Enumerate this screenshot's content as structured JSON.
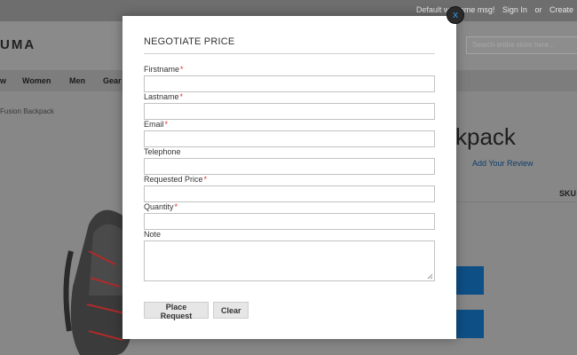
{
  "topbar": {
    "welcome": "Default welcome msg!",
    "sign_in": "Sign In",
    "or": "or",
    "create": "Create"
  },
  "header": {
    "logo_text": "UMA",
    "search_placeholder": "Search entire store here..."
  },
  "nav": {
    "items": [
      {
        "label": "w"
      },
      {
        "label": "Women"
      },
      {
        "label": "Men"
      },
      {
        "label": "Gear"
      }
    ]
  },
  "main": {
    "breadcrumb": "Fusion Backpack",
    "product_title": "kpack",
    "review_link": "Add Your Review",
    "sku_label": "SKU"
  },
  "modal": {
    "title": "NEGOTIATE PRICE",
    "close_label": "x",
    "fields": [
      {
        "label": "Firstname",
        "required": "*",
        "value": ""
      },
      {
        "label": "Lastname",
        "required": "*",
        "value": ""
      },
      {
        "label": "Email",
        "required": "*",
        "value": ""
      },
      {
        "label": "Telephone",
        "required": "",
        "value": ""
      },
      {
        "label": "Requested Price",
        "required": "*",
        "value": ""
      },
      {
        "label": "Quantity",
        "required": "*",
        "value": ""
      },
      {
        "label": "Note",
        "required": "",
        "value": ""
      }
    ],
    "place_request_label": "Place Request",
    "clear_label": "Clear"
  },
  "colors": {
    "overlay_bg": "#878787",
    "topbar_bg": "#6e6e6e",
    "required_star": "#e02b27",
    "primary_button": "#0e4f85",
    "close_icon": "#3a8fd6"
  }
}
